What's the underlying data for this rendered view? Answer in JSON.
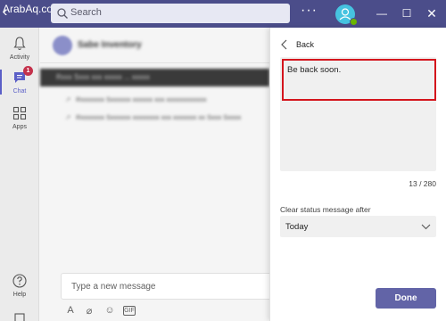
{
  "titlebar": {
    "watermark": "ArabAq.com",
    "search_placeholder": "Search",
    "more_label": "···"
  },
  "rail": {
    "items": [
      {
        "label": "Activity",
        "icon": "bell-icon"
      },
      {
        "label": "Chat",
        "icon": "chat-icon",
        "badge": "1"
      },
      {
        "label": "Apps",
        "icon": "apps-icon"
      },
      {
        "label": "Help",
        "icon": "help-icon"
      }
    ]
  },
  "chat": {
    "title": "Sabe Inventory",
    "banner": "Rxxx Sxxx xxx xxxxx ... xxxxx",
    "lines": [
      "Rxxxxxxx Sxxxxxx xxxxxx xxx xxxxxxxxxxxx",
      "Rxxxxxxx Sxxxxxx xxxxxxxx xxx xxxxxxx xx Sxxx Sxxxx"
    ],
    "compose_placeholder": "Type a new message"
  },
  "status_panel": {
    "back_label": "Back",
    "message": "Be back soon.",
    "counter": "13 / 280",
    "clear_after_label": "Clear status message after",
    "clear_after_value": "Today",
    "done_label": "Done"
  },
  "colors": {
    "titlebar": "#4b4d8a",
    "accent": "#6264a7",
    "highlight": "#d4151d",
    "badge": "#c4314b",
    "presence": "#6bb700"
  }
}
